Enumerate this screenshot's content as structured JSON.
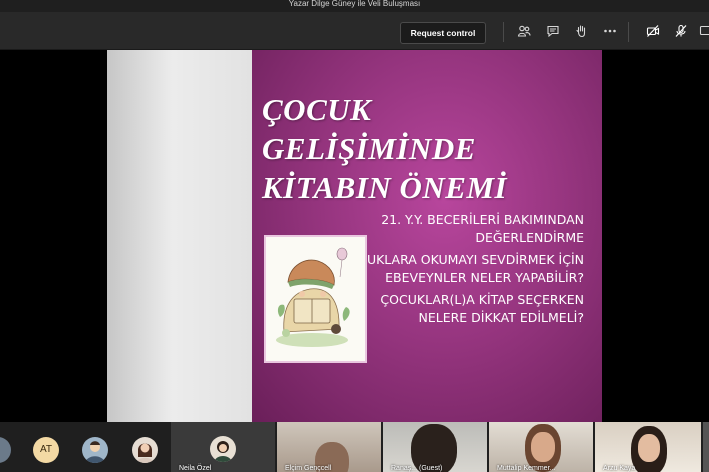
{
  "window": {
    "title": "Yazar Dilge Güney ile Veli Buluşması"
  },
  "toolbar": {
    "request_control_label": "Request control",
    "icons": [
      "participants-icon",
      "chat-icon",
      "raise-hand-icon",
      "more-options-icon",
      "camera-off-icon",
      "mic-off-icon",
      "share-icon"
    ]
  },
  "slide": {
    "title_lines": [
      "ÇOCUK",
      "GELİŞİMİNDE",
      "KİTABIN ÖNEMİ"
    ],
    "bullets": [
      "21. Y.Y. BECERİLERİ BAKIMINDAN DEĞERLENDİRME",
      "ÇOCUKLARA OKUMAYI SEVDİRMEK İÇİN EBEVEYNLER NELER YAPABİLİR?",
      "ÇOCUKLAR(L)A KİTAP SEÇERKEN NELERE DİKKAT EDİLMELİ?"
    ]
  },
  "participants": {
    "avatar_initials": "AT",
    "tiles": [
      {
        "name": "Neila Özel"
      },
      {
        "name": "Elçim Gençcell"
      },
      {
        "name": "Ranaş... (Guest)"
      },
      {
        "name": "Muttalip Kemmer..."
      },
      {
        "name": "Arzu Kaya"
      }
    ]
  },
  "colors": {
    "slide_magenta": "#96357f",
    "toolbar_bg": "#292929",
    "avatar_bg": "#f3d9a4"
  }
}
